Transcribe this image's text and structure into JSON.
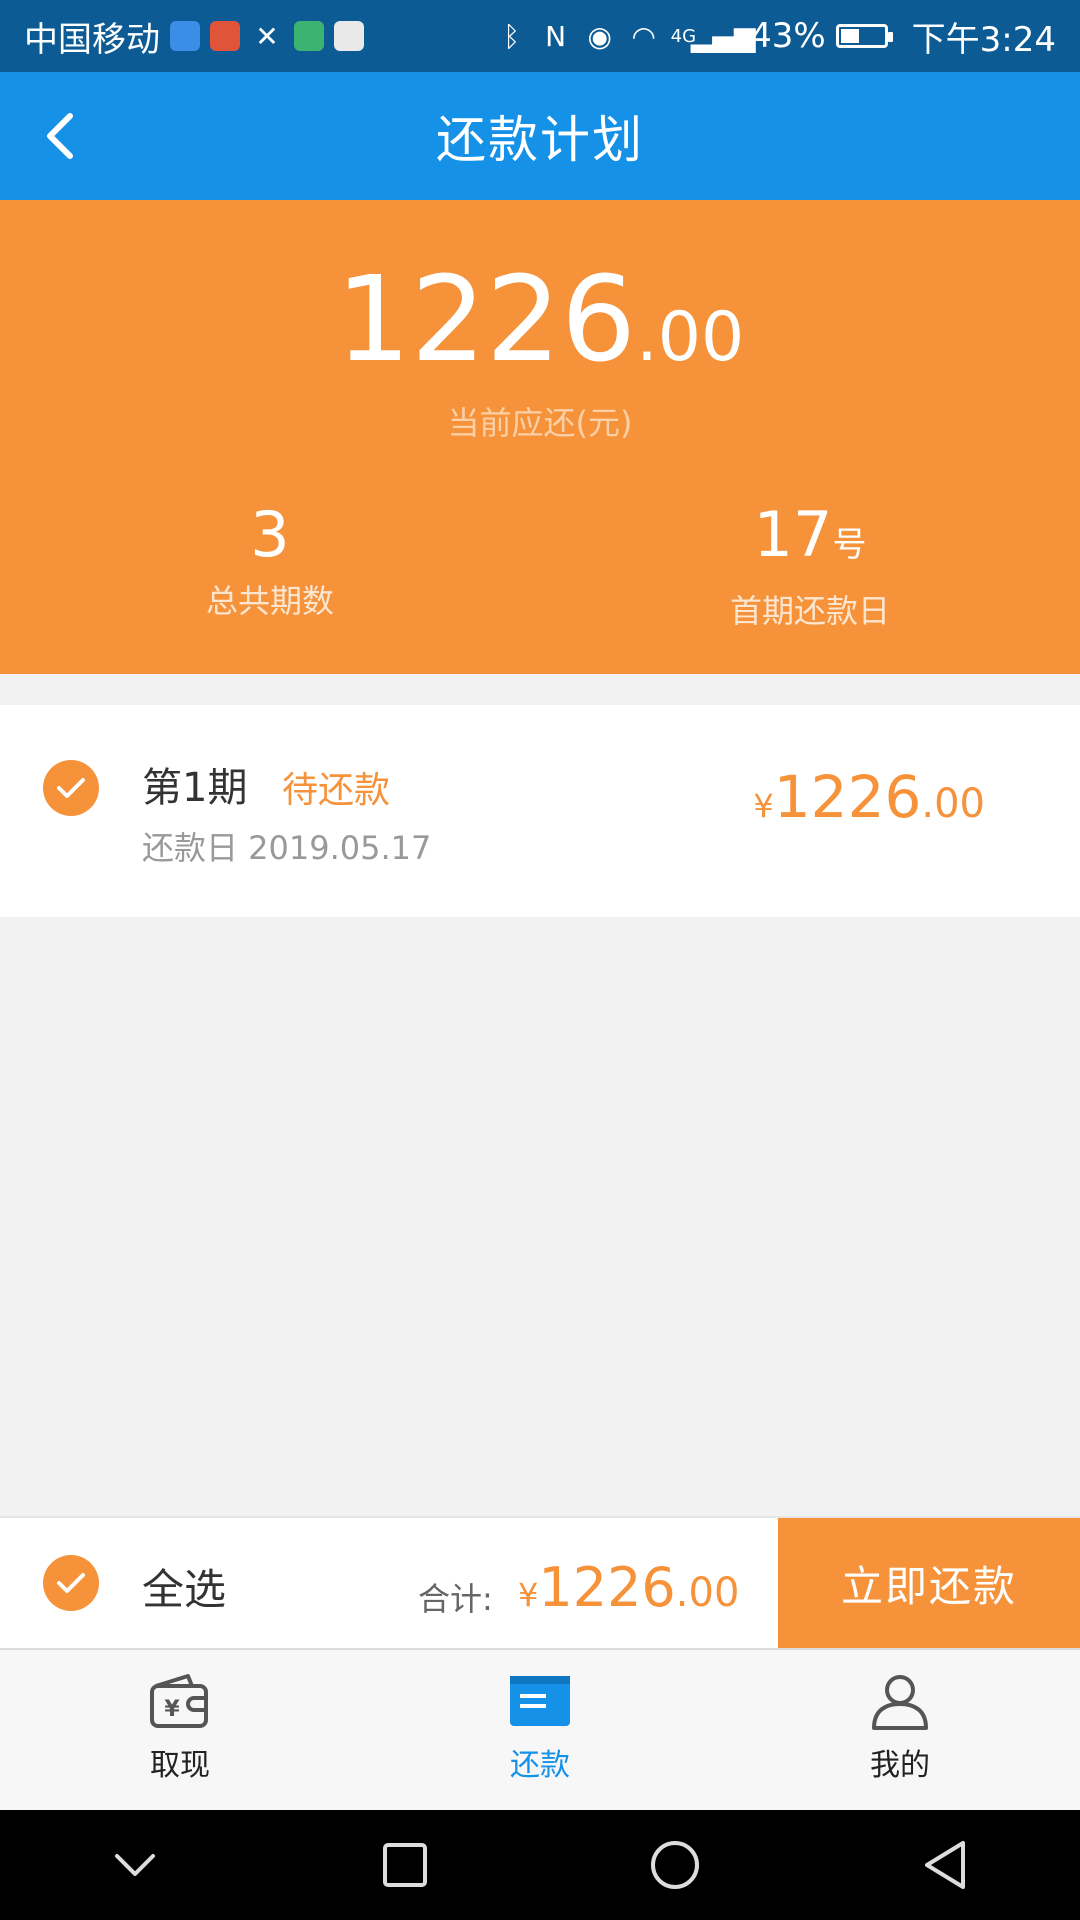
{
  "statusbar": {
    "carrier": "中国移动",
    "network": "4G",
    "battery_percent": "43%",
    "battery_level": 0.43,
    "time": "下午3:24"
  },
  "header": {
    "title": "还款计划",
    "back_icon": "chevron-left-icon"
  },
  "summary": {
    "amount_int": "1226",
    "amount_dec": ".00",
    "amount_label": "当前应还(元)",
    "periods_value": "3",
    "periods_label": "总共期数",
    "first_day_value": "17",
    "first_day_unit": "号",
    "first_day_label": "首期还款日"
  },
  "plan": {
    "items": [
      {
        "period": "第1期",
        "status": "待还款",
        "due_label": "还款日 2019.05.17",
        "currency": "¥",
        "amount_int": "1226",
        "amount_dec": ".00",
        "checked": true
      }
    ]
  },
  "paybar": {
    "select_all": "全选",
    "total_label": "合计:",
    "currency": "¥",
    "total_int": "1226",
    "total_dec": ".00",
    "pay_button": "立即还款"
  },
  "tabbar": {
    "items": [
      {
        "label": "取现",
        "icon": "wallet-icon"
      },
      {
        "label": "还款",
        "icon": "bill-icon",
        "active": true
      },
      {
        "label": "我的",
        "icon": "user-icon"
      }
    ]
  },
  "colors": {
    "primary_blue": "#1591e8",
    "accent_orange": "#f5923a",
    "status_bar": "#0d5b94"
  }
}
